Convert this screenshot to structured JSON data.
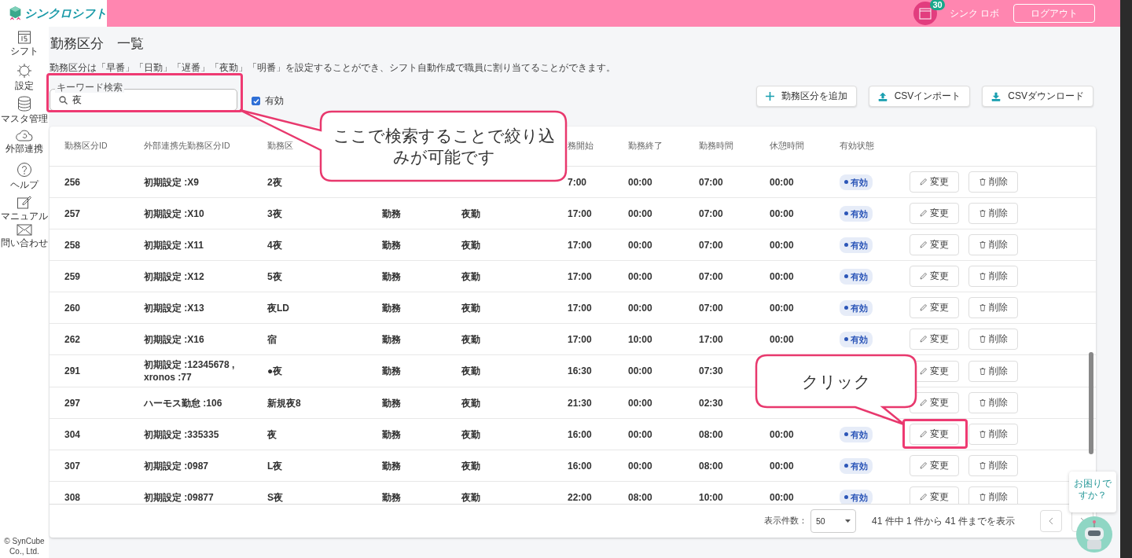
{
  "header": {
    "app_name": "シンクロシフト",
    "notification_count": "30",
    "user_name": "シンク ロボ",
    "logout": "ログアウト"
  },
  "sidebar": {
    "items": [
      {
        "label": "シフト"
      },
      {
        "label": "設定"
      },
      {
        "label": "マスタ管理"
      },
      {
        "label": "外部連携"
      },
      {
        "label": "ヘルプ"
      },
      {
        "label": "マニュアル"
      },
      {
        "label": "問い合わせ"
      }
    ],
    "copyright": "© SynCube Co., Ltd."
  },
  "page": {
    "title": "勤務区分　一覧",
    "description": "勤務区分は「早番」「日勤」「遅番」「夜勤」「明番」を設定することができ、シフト自動作成で職員に割り当てることができます。",
    "search": {
      "label": "キーワード検索",
      "value": "夜"
    },
    "filter": {
      "label": "有効",
      "checked": true
    },
    "actions": [
      {
        "label": "勤務区分を追加",
        "kind": "add"
      },
      {
        "label": "CSVインポート",
        "kind": "upload"
      },
      {
        "label": "CSVダウンロード",
        "kind": "download"
      }
    ]
  },
  "table": {
    "columns": [
      "勤務区分ID",
      "外部連携先勤務区分ID",
      "勤務区",
      null,
      null,
      "務開始",
      "勤務終了",
      "勤務時間",
      "休憩時間",
      "有効状態"
    ],
    "rows": [
      {
        "id": "256",
        "external_id": "初期設定 :X9",
        "name": "2夜",
        "start": "7:00",
        "end": "00:00",
        "hours": "07:00",
        "rest": "00:00",
        "status": {
          "label": "有効",
          "active": true
        },
        "edit": "変更",
        "delete": "削除"
      },
      {
        "id": "257",
        "external_id": "初期設定 :X10",
        "name": "3夜",
        "type": "勤務",
        "category": "夜勤",
        "start": "17:00",
        "end": "00:00",
        "hours": "07:00",
        "rest": "00:00",
        "status": {
          "label": "有効",
          "active": true
        },
        "edit": "変更",
        "delete": "削除"
      },
      {
        "id": "258",
        "external_id": "初期設定 :X11",
        "name": "4夜",
        "type": "勤務",
        "category": "夜勤",
        "start": "17:00",
        "end": "00:00",
        "hours": "07:00",
        "rest": "00:00",
        "status": {
          "label": "有効",
          "active": true
        },
        "edit": "変更",
        "delete": "削除"
      },
      {
        "id": "259",
        "external_id": "初期設定 :X12",
        "name": "5夜",
        "type": "勤務",
        "category": "夜勤",
        "start": "17:00",
        "end": "00:00",
        "hours": "07:00",
        "rest": "00:00",
        "status": {
          "label": "有効",
          "active": true
        },
        "edit": "変更",
        "delete": "削除"
      },
      {
        "id": "260",
        "external_id": "初期設定 :X13",
        "name": "夜LD",
        "type": "勤務",
        "category": "夜勤",
        "start": "17:00",
        "end": "00:00",
        "hours": "07:00",
        "rest": "00:00",
        "status": {
          "label": "有効",
          "active": true
        },
        "edit": "変更",
        "delete": "削除"
      },
      {
        "id": "262",
        "external_id": "初期設定 :X16",
        "name": "宿",
        "type": "勤務",
        "category": "夜勤",
        "start": "17:00",
        "end": "10:00",
        "hours": "17:00",
        "rest": "00:00",
        "status": {
          "label": "有効",
          "active": true
        },
        "edit": "変更",
        "delete": "削除"
      },
      {
        "id": "291",
        "external_id": "初期設定 :12345678 , xronos :77",
        "name": "●夜",
        "type": "勤務",
        "category": "夜勤",
        "start": "16:30",
        "end": "00:00",
        "hours": "07:30",
        "edit": "変更",
        "delete": "削除"
      },
      {
        "id": "297",
        "external_id": "ハーモス勤怠 :106",
        "name": "新規夜8",
        "type": "勤務",
        "category": "夜勤",
        "start": "21:30",
        "end": "00:00",
        "hours": "02:30",
        "edit": "変更",
        "delete": "削除"
      },
      {
        "id": "304",
        "external_id": "初期設定 :335335",
        "name": "夜",
        "type": "勤務",
        "category": "夜勤",
        "start": "16:00",
        "end": "00:00",
        "hours": "08:00",
        "rest": "00:00",
        "status": {
          "label": "有効",
          "active": true
        },
        "edit": "変更",
        "delete": "削除"
      },
      {
        "id": "307",
        "external_id": "初期設定 :0987",
        "name": "L夜",
        "type": "勤務",
        "category": "夜勤",
        "start": "16:00",
        "end": "00:00",
        "hours": "08:00",
        "rest": "00:00",
        "status": {
          "label": "有効",
          "active": true
        },
        "edit": "変更",
        "delete": "削除"
      },
      {
        "id": "308",
        "external_id": "初期設定 :09877",
        "name": "S夜",
        "type": "勤務",
        "category": "夜勤",
        "start": "22:00",
        "end": "08:00",
        "hours": "10:00",
        "rest": "00:00",
        "status": {
          "label": "有効",
          "active": true
        },
        "edit": "変更",
        "delete": "削除"
      }
    ],
    "footer": {
      "per_page_label": "表示件数：",
      "per_page": "50",
      "range": "41 件中 1 件から 41 件までを表示"
    }
  },
  "callouts": [
    {
      "text": "ここで検索することで絞り込みが可能です"
    },
    {
      "text": "クリック"
    }
  ],
  "help_widget": {
    "text": "お困りですか？"
  }
}
